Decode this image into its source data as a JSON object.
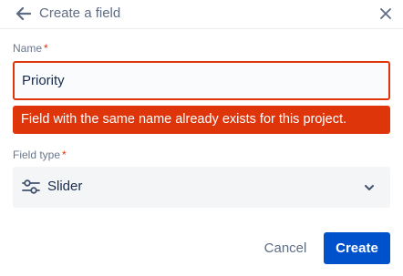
{
  "dialog": {
    "title": "Create a field",
    "back_icon": "arrow-left-icon",
    "close_icon": "close-icon"
  },
  "name_field": {
    "label": "Name",
    "required_marker": "*",
    "value": "Priority",
    "error": "Field with the same name already exists for this project."
  },
  "field_type": {
    "label": "Field type",
    "required_marker": "*",
    "selected": "Slider",
    "icon": "slider-icon",
    "chevron_icon": "chevron-down-icon"
  },
  "footer": {
    "cancel_label": "Cancel",
    "create_label": "Create"
  },
  "colors": {
    "error": "#de350b",
    "primary": "#0052cc",
    "select_bg": "#f4f5f7"
  }
}
